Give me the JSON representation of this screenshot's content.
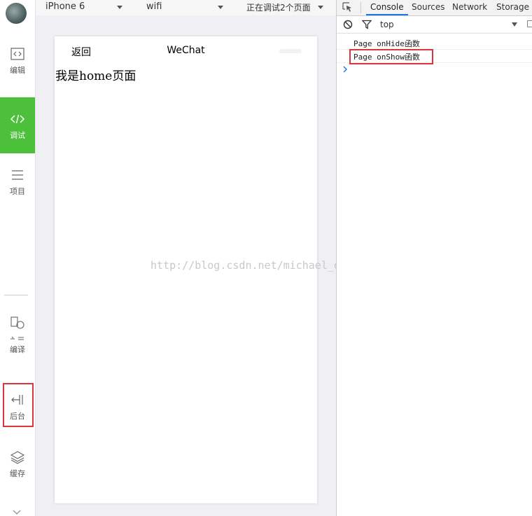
{
  "sidebar": {
    "items": [
      {
        "label": "编辑",
        "icon": "editor-icon"
      },
      {
        "label": "调试",
        "icon": "debug-code-icon",
        "active": true
      },
      {
        "label": "项目",
        "icon": "project-menu-icon"
      },
      {
        "label": "编译",
        "icon": "compile-icon"
      },
      {
        "label": "后台",
        "icon": "background-icon"
      },
      {
        "label": "缓存",
        "icon": "cache-layers-icon"
      }
    ]
  },
  "simulator_toolbar": {
    "device": "iPhone 6",
    "network": "wifi",
    "debug_status": "正在调试2个页面"
  },
  "phone": {
    "back_label": "返回",
    "title": "WeChat",
    "page_text": "我是home页面"
  },
  "watermark": "http://blog.csdn.net/michael_ouyang",
  "devtools": {
    "tabs": [
      "Console",
      "Sources",
      "Network",
      "Storage"
    ],
    "active_tab": "Console",
    "context": "top",
    "console_lines": [
      "Page onHide函数",
      "Page onShow函数"
    ]
  },
  "colors": {
    "active_green": "#4cbf3b",
    "highlight_red": "#d9363e",
    "accent_blue": "#1a73e8"
  }
}
